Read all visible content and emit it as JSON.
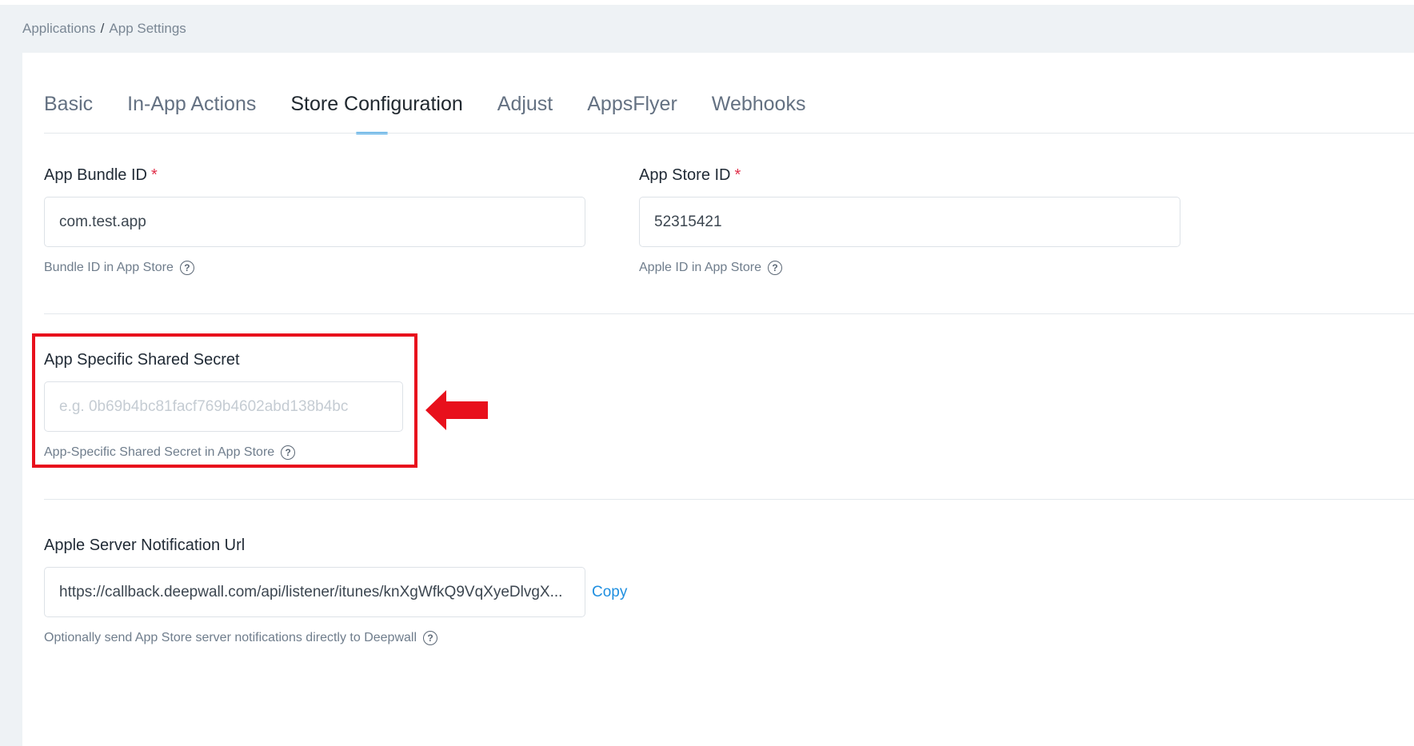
{
  "breadcrumb": {
    "items": [
      "Applications",
      "App Settings"
    ],
    "separator": "/"
  },
  "tabs": [
    {
      "label": "Basic"
    },
    {
      "label": "In-App Actions"
    },
    {
      "label": "Store Configuration",
      "active": true
    },
    {
      "label": "Adjust"
    },
    {
      "label": "AppsFlyer"
    },
    {
      "label": "Webhooks"
    }
  ],
  "form": {
    "bundle_id": {
      "label": "App Bundle ID",
      "required_mark": "*",
      "value": "com.test.app",
      "hint": "Bundle ID in App Store"
    },
    "store_id": {
      "label": "App Store ID",
      "required_mark": "*",
      "value": "52315421",
      "hint": "Apple ID in App Store"
    },
    "shared_secret": {
      "label": "App Specific Shared Secret",
      "value": "",
      "placeholder": "e.g. 0b69b4bc81facf769b4602abd138b4bc",
      "hint": "App-Specific Shared Secret in App Store"
    },
    "notification_url": {
      "label": "Apple Server Notification Url",
      "value": "https://callback.deepwall.com/api/listener/itunes/knXgWfkQ9VqXyeDlvgX...",
      "copy_label": "Copy",
      "hint": "Optionally send App Store server notifications directly to Deepwall"
    }
  },
  "help_glyph": "?",
  "colors": {
    "accent": "#2f9ee6",
    "required": "#e0304a",
    "highlight": "#e8101c",
    "link": "#1f8fe0"
  },
  "icons": {
    "help": "question-circle-icon",
    "annotation": "arrow-left-icon"
  }
}
